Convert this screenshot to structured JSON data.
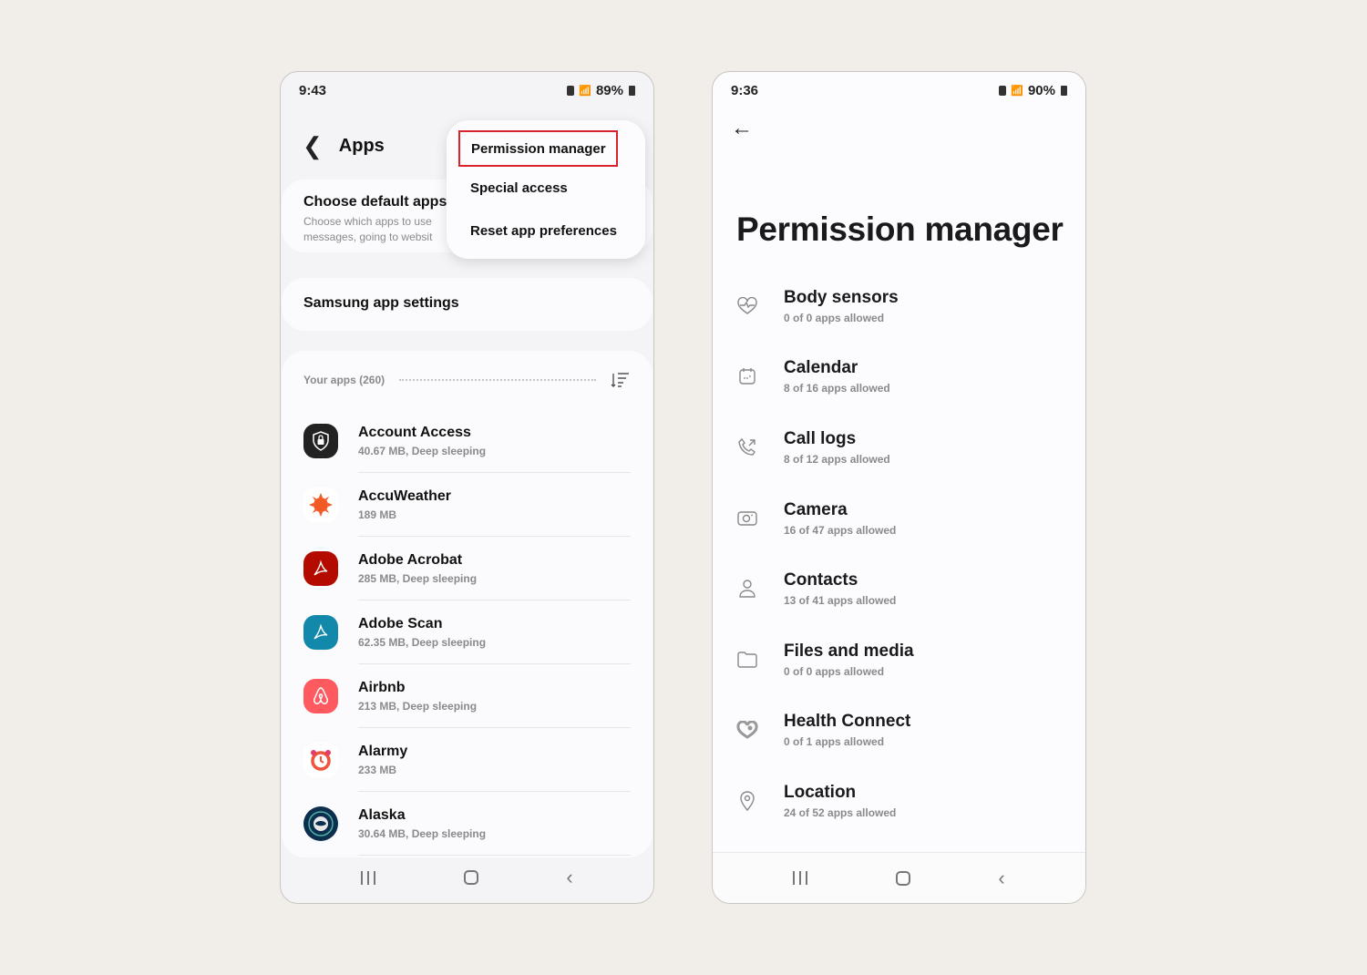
{
  "left_phone": {
    "status": {
      "time": "9:43",
      "battery": "89%"
    },
    "header": {
      "title": "Apps",
      "back_icon": "chevron-left"
    },
    "default_apps_card": {
      "title": "Choose default apps",
      "subtitle_line1": "Choose which apps to use",
      "subtitle_line2": "messages, going to websit"
    },
    "samsung_card": {
      "title": "Samsung app settings"
    },
    "apps_section": {
      "label": "Your apps (260)",
      "sort_icon": "sort-icon",
      "apps": [
        {
          "name": "Account Access",
          "meta": "40.67 MB, Deep sleeping",
          "icon": "shield-lock",
          "color": "#222222"
        },
        {
          "name": "AccuWeather",
          "meta": "189 MB",
          "icon": "sun",
          "color": "#f15a24"
        },
        {
          "name": "Adobe Acrobat",
          "meta": "285 MB, Deep sleeping",
          "icon": "acrobat",
          "color": "#b30b00"
        },
        {
          "name": "Adobe Scan",
          "meta": "62.35 MB, Deep sleeping",
          "icon": "acrobat",
          "color": "#1289aa"
        },
        {
          "name": "Airbnb",
          "meta": "213 MB, Deep sleeping",
          "icon": "airbnb",
          "color": "#ff5a5f"
        },
        {
          "name": "Alarmy",
          "meta": "233 MB",
          "icon": "alarm-clock",
          "color": "#f0533a"
        },
        {
          "name": "Alaska",
          "meta": "30.64 MB, Deep sleeping",
          "icon": "alaska-face",
          "color": "#0c2f4d"
        }
      ]
    },
    "popup_menu": {
      "items": [
        "Permission manager",
        "Special access",
        "Reset app preferences"
      ],
      "highlight_color": "#d8232a"
    }
  },
  "right_phone": {
    "status": {
      "time": "9:36",
      "battery": "90%"
    },
    "title": "Permission manager",
    "permissions": [
      {
        "name": "Body sensors",
        "count": "0 of 0 apps allowed",
        "icon": "heart-pulse"
      },
      {
        "name": "Calendar",
        "count": "8 of 16 apps allowed",
        "icon": "calendar"
      },
      {
        "name": "Call logs",
        "count": "8 of 12 apps allowed",
        "icon": "phone-call"
      },
      {
        "name": "Camera",
        "count": "16 of 47 apps allowed",
        "icon": "camera"
      },
      {
        "name": "Contacts",
        "count": "13 of 41 apps allowed",
        "icon": "person"
      },
      {
        "name": "Files and media",
        "count": "0 of 0 apps allowed",
        "icon": "folder"
      },
      {
        "name": "Health Connect",
        "count": "0 of 1 apps allowed",
        "icon": "health-connect"
      },
      {
        "name": "Location",
        "count": "24 of 52 apps allowed",
        "icon": "location-pin"
      }
    ]
  }
}
